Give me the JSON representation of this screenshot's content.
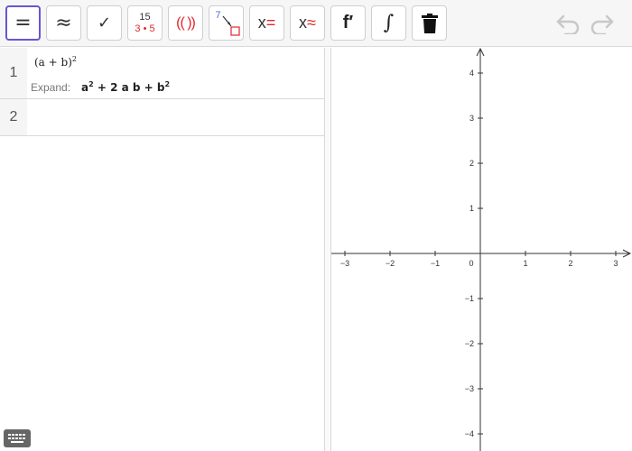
{
  "toolbar": {
    "buttons": [
      {
        "name": "evaluate-button",
        "symbol": "="
      },
      {
        "name": "numeric-button",
        "symbol": "≈"
      },
      {
        "name": "check-input-button",
        "symbol": "✓"
      },
      {
        "name": "factor-number-button",
        "top": "15",
        "bottom": "3 • 5"
      },
      {
        "name": "expand-button",
        "symbol": "(( ))"
      },
      {
        "name": "substitute-button",
        "symbol": "7"
      },
      {
        "name": "solve-button",
        "symbol": "x="
      },
      {
        "name": "numeric-solve-button",
        "symbol": "x≈"
      },
      {
        "name": "derivative-button",
        "symbol": "f′"
      },
      {
        "name": "integral-button",
        "symbol": "∫"
      },
      {
        "name": "delete-button",
        "symbol": "trash-icon"
      }
    ],
    "undo_icon": "undo-icon",
    "redo_icon": "redo-icon"
  },
  "algebra": {
    "rows": [
      {
        "number": "1",
        "input_base": "(a + b)",
        "input_exp": "2",
        "output_label": "Expand:",
        "output": {
          "a": "a",
          "a_exp": "2",
          "mid": " + 2 a b + b",
          "b_exp": "2"
        }
      },
      {
        "number": "2"
      }
    ]
  },
  "graphics": {
    "x_ticks": [
      "−3",
      "−2",
      "−1",
      "0",
      "1",
      "2",
      "3"
    ],
    "y_ticks": [
      "4",
      "3",
      "2",
      "1",
      "−1",
      "−2",
      "−3",
      "−4"
    ]
  },
  "colors": {
    "accent": "#6557d2",
    "red": "#e0262c",
    "blue": "#4a6ee0"
  }
}
